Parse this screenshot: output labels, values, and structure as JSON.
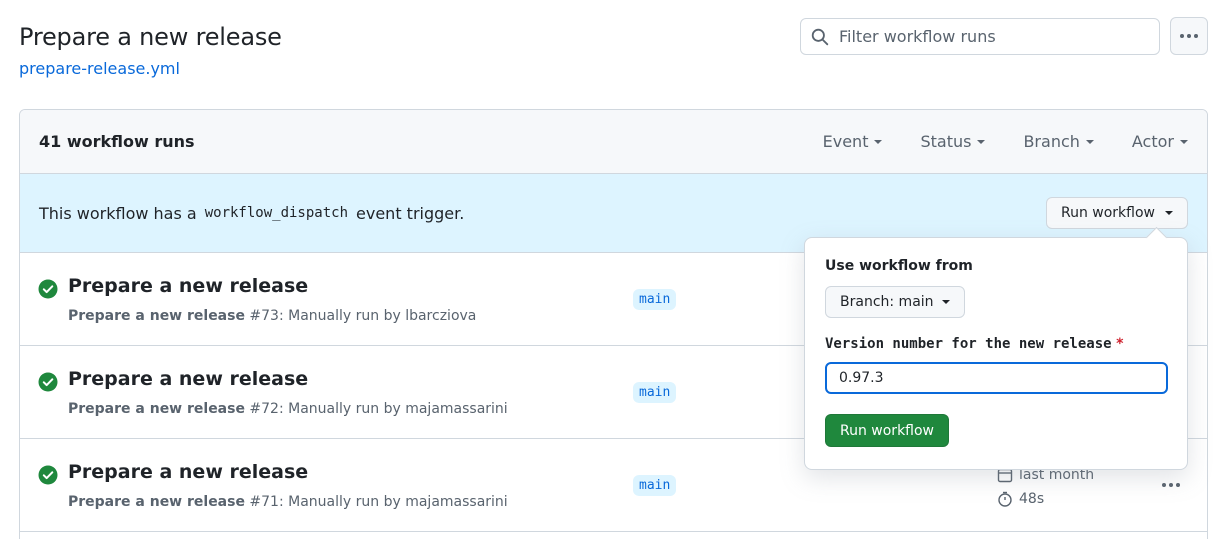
{
  "page": {
    "title": "Prepare a new release",
    "file_link": "prepare-release.yml"
  },
  "search": {
    "placeholder": "Filter workflow runs"
  },
  "header": {
    "runs_count": "41 workflow runs",
    "filters": [
      "Event",
      "Status",
      "Branch",
      "Actor"
    ]
  },
  "dispatch": {
    "text_before": "This workflow has a",
    "code": "workflow_dispatch",
    "text_after": "event trigger.",
    "run_button": "Run workflow"
  },
  "runs": [
    {
      "title": "Prepare a new release",
      "workflow": "Prepare a new release",
      "detail": "#73: Manually run by lbarcziova",
      "branch": "main"
    },
    {
      "title": "Prepare a new release",
      "workflow": "Prepare a new release",
      "detail": "#72: Manually run by majamassarini",
      "branch": "main"
    },
    {
      "title": "Prepare a new release",
      "workflow": "Prepare a new release",
      "detail": "#71: Manually run by majamassarini",
      "branch": "main",
      "date": "last month",
      "duration": "48s"
    }
  ],
  "popover": {
    "heading": "Use workflow from",
    "branch_select": "Branch: main",
    "field_label": "Version number for the new release",
    "required_mark": "*",
    "version_value": "0.97.3",
    "submit": "Run workflow"
  },
  "colors": {
    "link": "#0969da",
    "success": "#1f883d",
    "dispatch_bg": "#ddf4ff",
    "required": "#cf222e"
  }
}
